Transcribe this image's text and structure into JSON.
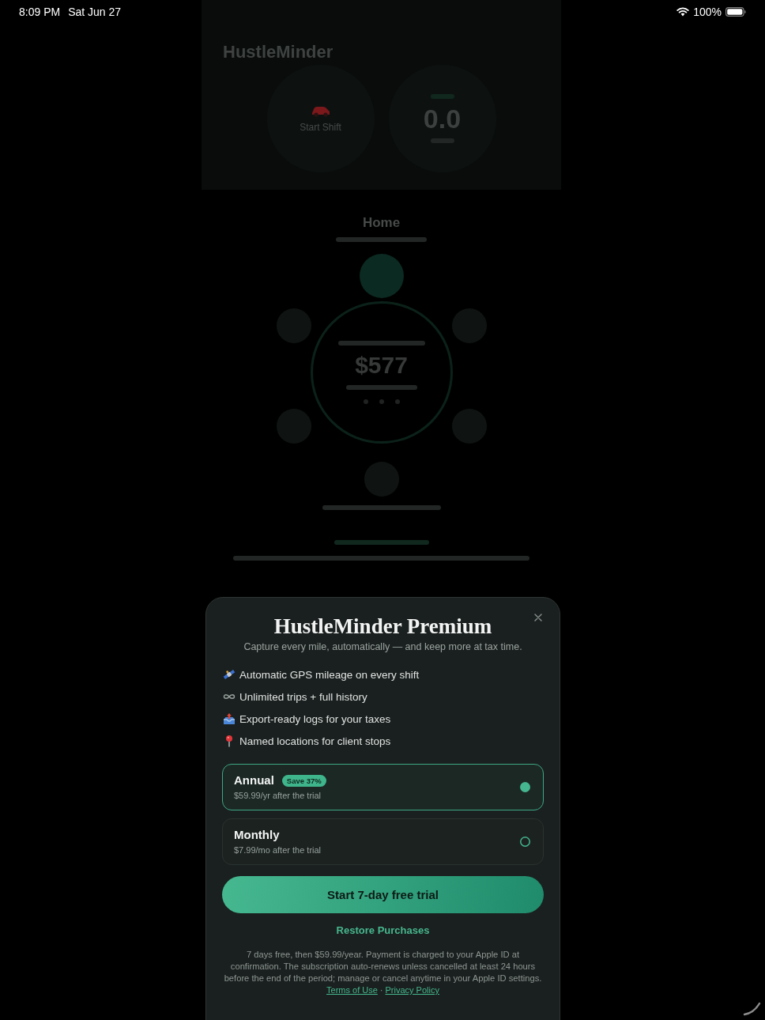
{
  "status_bar": {
    "time": "8:09 PM",
    "date": "Sat Jun 27",
    "battery": "100%"
  },
  "background_app": {
    "title": "HustleMinder",
    "shift_label": "Start Shift",
    "miles_value": "0.0",
    "section_title": "Home",
    "earnings_value": "$577"
  },
  "paywall": {
    "title": "HustleMinder Premium",
    "subtitle": "Capture every mile, automatically — and keep more at tax time.",
    "features": [
      {
        "kind": "satellite",
        "text": "Automatic GPS mileage on every shift"
      },
      {
        "kind": "infinity",
        "text": "Unlimited trips + full history"
      },
      {
        "kind": "outbox",
        "text": "Export-ready logs for your taxes"
      },
      {
        "kind": "pin",
        "text": "Named locations for client stops"
      }
    ],
    "plans": [
      {
        "name": "Annual",
        "badge": "Save 37%",
        "price": "$59.99/yr after the trial",
        "selected": true
      },
      {
        "name": "Monthly",
        "price": "$7.99/mo after the trial",
        "selected": false
      }
    ],
    "cta": "Start 7-day free trial",
    "restore": "Restore Purchases",
    "fine_print": "7 days free, then $59.99/year. Payment is charged to your Apple ID at confirmation. The subscription auto-renews unless cancelled at least 24 hours before the end of the period; manage or cancel anytime in your Apple ID settings.",
    "links": [
      "Terms of Use",
      "Privacy Policy"
    ],
    "link_separator": "·"
  }
}
